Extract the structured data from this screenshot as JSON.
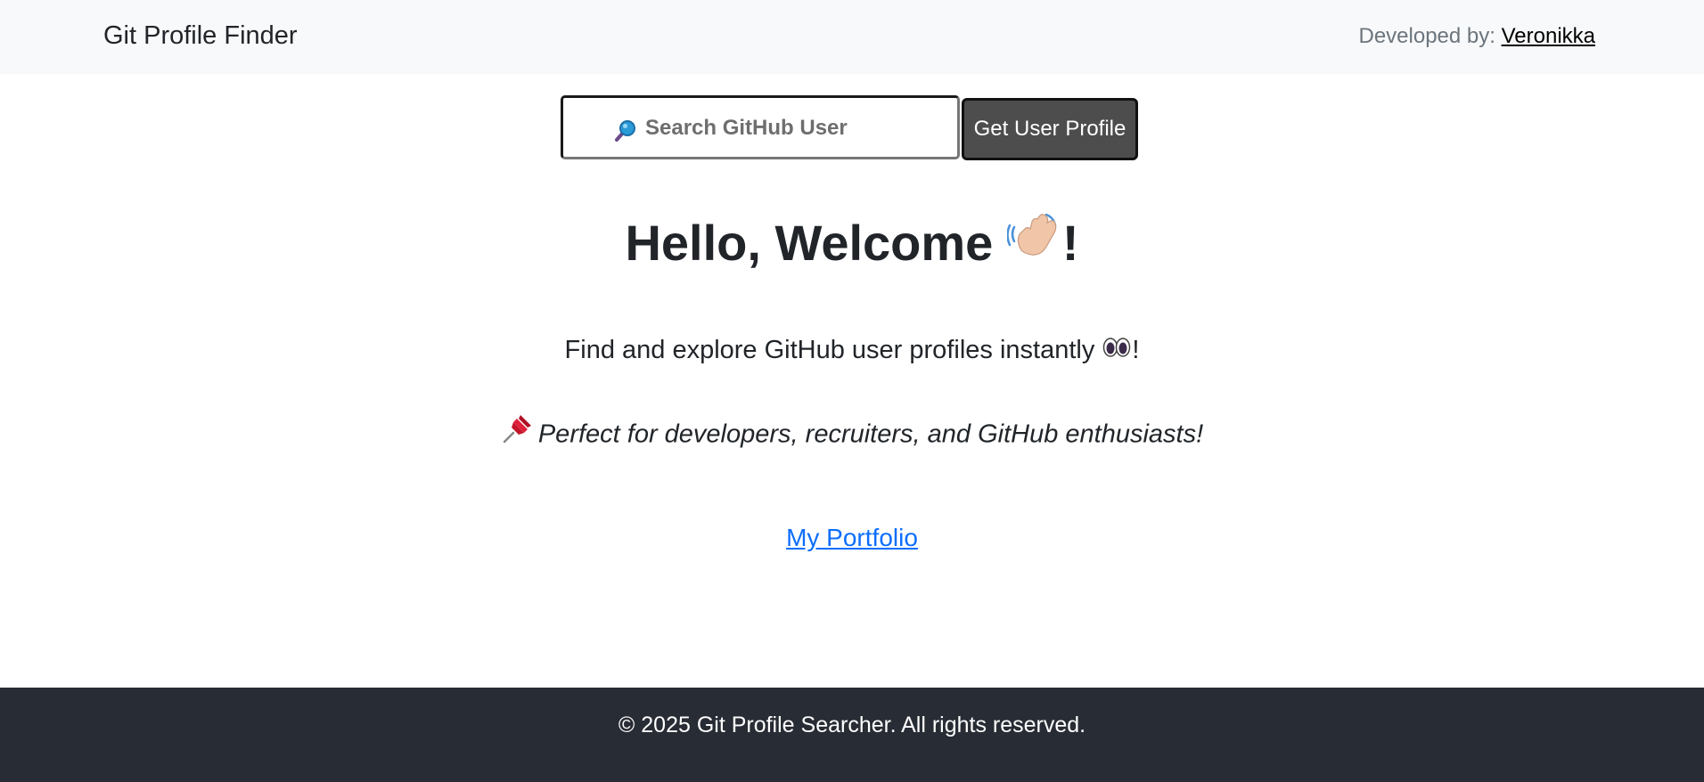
{
  "navbar": {
    "brand": "Git Profile Finder",
    "developed_by_label": "Developed by: ",
    "developer_name": "Veronikka"
  },
  "search": {
    "placeholder": "Search GitHub User",
    "value": "",
    "button_label": "Get User Profile",
    "icon": "magnifier-icon"
  },
  "hero": {
    "welcome_text": "Hello, Welcome ",
    "welcome_suffix": "!",
    "welcome_icon": "waving-hand-icon",
    "tagline_text": "Find and explore GitHub user profiles instantly ",
    "tagline_suffix": "!",
    "tagline_icon": "eyes-icon",
    "perfect_icon": "pushpin-icon",
    "perfect_text": "Perfect for developers, recruiters, and GitHub enthusiasts!",
    "portfolio_link": "My Portfolio"
  },
  "footer": {
    "text": "© 2025 Git Profile Searcher. All rights reserved."
  },
  "colors": {
    "navbar_bg": "#f8f9fa",
    "footer_bg": "#282c34",
    "button_bg": "#4d4d4d",
    "link": "#0d6efd"
  }
}
